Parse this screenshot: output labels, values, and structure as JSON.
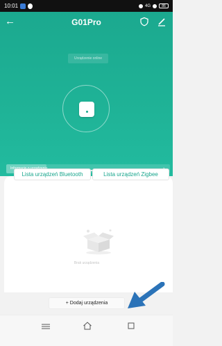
{
  "status_bar": {
    "time": "10:01",
    "signal_text": "4G",
    "battery_level": "86"
  },
  "header": {
    "title": "G01Pro",
    "back_icon": "arrow-left-icon",
    "shield_icon": "shield-icon",
    "edit_icon": "pencil-icon"
  },
  "device": {
    "status_text": "Urządzenie online",
    "info_label": "Informacje o urządzeniu"
  },
  "tabs": [
    {
      "label": "Lista urządzeń Bluetooth"
    },
    {
      "label": "Lista urządzeń Zigbee"
    }
  ],
  "empty_state": {
    "label": "Brak urządzenia",
    "icon": "empty-box-icon"
  },
  "add_button": {
    "label": "+ Dodaj urządzenia"
  },
  "annotation": {
    "icon": "blue-arrow-icon",
    "color": "#2b73b8"
  },
  "colors": {
    "accent": "#1ba98f",
    "tab_text": "#17a58c"
  }
}
